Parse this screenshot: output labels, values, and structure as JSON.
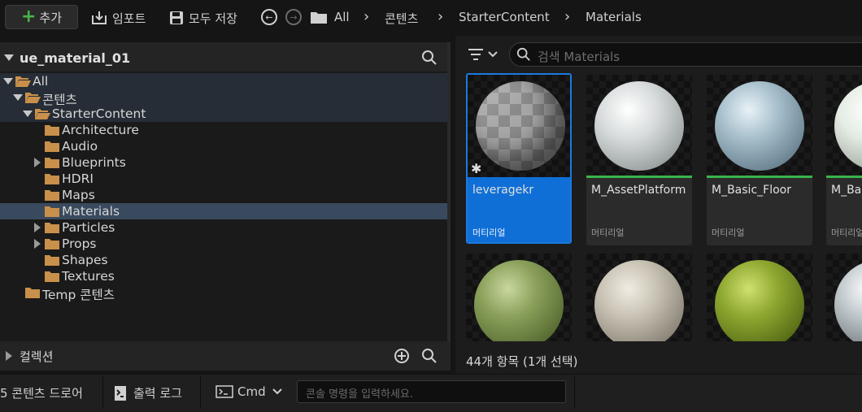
{
  "toolbar": {
    "add_label": "추가",
    "import_label": "임포트",
    "save_all_label": "모두 저장",
    "breadcrumbs": [
      "All",
      "콘텐츠",
      "StarterContent",
      "Materials"
    ]
  },
  "left_panel": {
    "title": "ue_material_01",
    "tree": [
      {
        "label": "All",
        "depth": 0,
        "expanded": true
      },
      {
        "label": "콘텐츠",
        "depth": 1,
        "expanded": true
      },
      {
        "label": "StarterContent",
        "depth": 2,
        "expanded": true
      },
      {
        "label": "Architecture",
        "depth": 3,
        "expandable": false
      },
      {
        "label": "Audio",
        "depth": 3,
        "expandable": false
      },
      {
        "label": "Blueprints",
        "depth": 3,
        "expandable": true
      },
      {
        "label": "HDRI",
        "depth": 3,
        "expandable": false
      },
      {
        "label": "Maps",
        "depth": 3,
        "expandable": false
      },
      {
        "label": "Materials",
        "depth": 3,
        "selected": true
      },
      {
        "label": "Particles",
        "depth": 3,
        "expandable": true
      },
      {
        "label": "Props",
        "depth": 3,
        "expandable": true
      },
      {
        "label": "Shapes",
        "depth": 3,
        "expandable": false
      },
      {
        "label": "Textures",
        "depth": 3,
        "expandable": false
      },
      {
        "label": "Temp 콘텐츠",
        "depth": 1,
        "expandable": false
      }
    ],
    "collections_label": "컬렉션"
  },
  "content": {
    "search_placeholder": "검색 Materials",
    "assets": [
      {
        "name": "leveragekr",
        "type": "머티리얼",
        "selected": true
      },
      {
        "name": "M_AssetPlatform",
        "type": "머티리얼"
      },
      {
        "name": "M_Basic_Floor",
        "type": "머티리얼"
      },
      {
        "name": "M_Bas",
        "type": "머티리얼"
      }
    ],
    "item_count": "44개 항목 (1개 선택)"
  },
  "bottom_bar": {
    "content_drawer": "5 콘텐츠 드로어",
    "output_log": "출력 로그",
    "cmd": "Cmd",
    "console_placeholder": "콘솔 명령을 입력하세요."
  },
  "colors": {
    "accent": "#0f6fd6",
    "folder": "#c8904a",
    "asset_bar": "#39b54a",
    "add_plus": "#4ab34a"
  }
}
